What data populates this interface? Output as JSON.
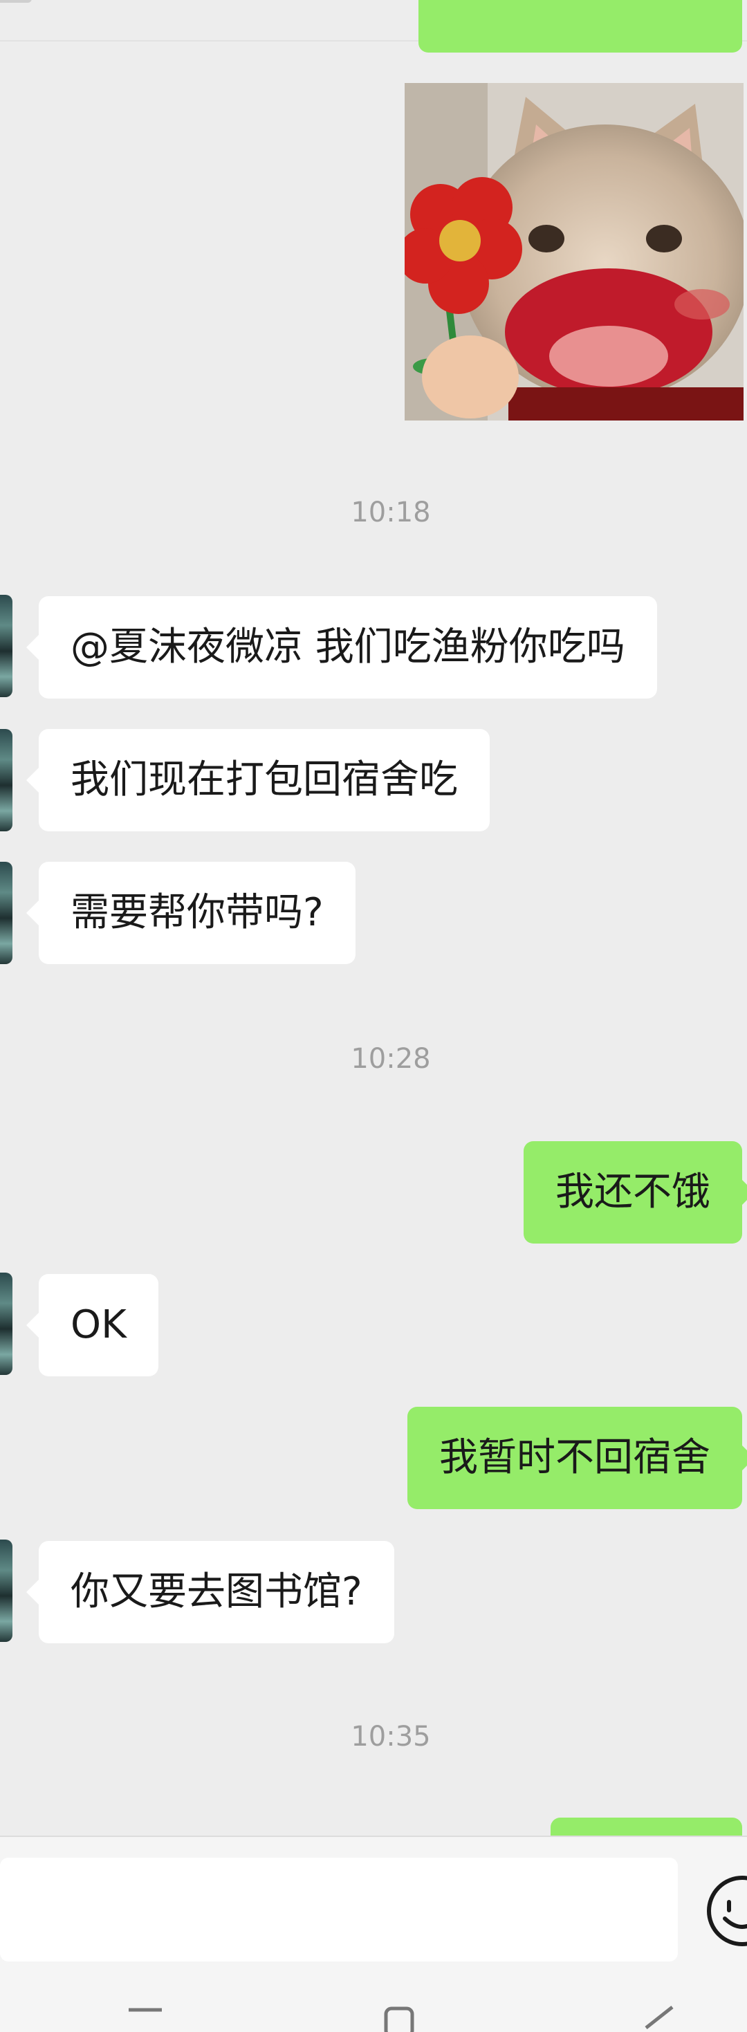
{
  "messages": [
    {
      "kind": "in",
      "text": "@夏沫夜微凉  我们吃渔粉你吃吗"
    },
    {
      "kind": "in",
      "text": "我们现在打包回宿舍吃"
    },
    {
      "kind": "in",
      "text": "需要帮你带吗?"
    },
    {
      "kind": "out",
      "text": "我还不饿"
    },
    {
      "kind": "in",
      "text": "OK"
    },
    {
      "kind": "out",
      "text": "我暂时不回宿舍"
    },
    {
      "kind": "in",
      "text": "你又要去图书馆?"
    }
  ],
  "timestamps": [
    "10:18",
    "10:28",
    "10:35"
  ],
  "icons": {
    "emoji": "emoji-face-icon",
    "back": "back-triangle-icon",
    "home": "home-square-icon",
    "recents": "recents-menu-icon"
  },
  "colors": {
    "background": "#ededed",
    "incoming_bubble": "#ffffff",
    "outgoing_bubble": "#95ec69",
    "timestamp": "#9e9e9e"
  }
}
